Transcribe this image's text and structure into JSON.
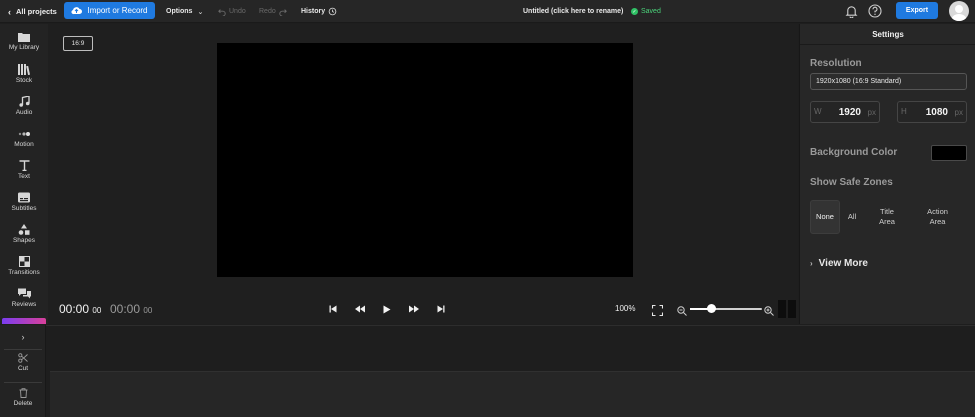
{
  "topbar": {
    "back_label": "All projects",
    "import_label": "Import or Record",
    "options_label": "Options",
    "undo_label": "Undo",
    "redo_label": "Redo",
    "history_label": "History",
    "project_title": "Untitled (click here to rename)",
    "saved_label": "Saved",
    "export_label": "Export"
  },
  "sidebar": {
    "items": [
      {
        "label": "My Library",
        "icon": "folder-icon"
      },
      {
        "label": "Stock",
        "icon": "stock-icon"
      },
      {
        "label": "Audio",
        "icon": "music-note-icon"
      },
      {
        "label": "Motion",
        "icon": "motion-icon"
      },
      {
        "label": "Text",
        "icon": "text-icon"
      },
      {
        "label": "Subtitles",
        "icon": "subtitles-icon"
      },
      {
        "label": "Shapes",
        "icon": "shapes-icon"
      },
      {
        "label": "Transitions",
        "icon": "transitions-icon"
      },
      {
        "label": "Reviews",
        "icon": "reviews-icon"
      }
    ]
  },
  "canvas": {
    "aspect_ratio": "16:9",
    "background_color": "#000000"
  },
  "playback": {
    "current_time": "00:00",
    "current_frames": "00",
    "total_time": "00:00",
    "total_frames": "00",
    "zoom_percent": "100%",
    "zoom_level": 0.3
  },
  "settings": {
    "header": "Settings",
    "resolution_label": "Resolution",
    "resolution_value": "1920x1080 (16:9 Standard)",
    "width_prefix": "W",
    "width_value": "1920",
    "height_prefix": "H",
    "height_value": "1080",
    "unit": "px",
    "background_color_label": "Background Color",
    "background_color_value": "#000000",
    "safe_zones_label": "Show Safe Zones",
    "safe_zones": [
      {
        "label": "None",
        "active": true
      },
      {
        "label": "All",
        "active": false
      },
      {
        "label": "Title Area",
        "active": false
      },
      {
        "label": "Action Area",
        "active": false
      }
    ],
    "view_more_label": "View More"
  },
  "timeline": {
    "cut_label": "Cut",
    "delete_label": "Delete"
  },
  "colors": {
    "accent": "#1f7ae0",
    "saved_green": "#2fc165"
  }
}
